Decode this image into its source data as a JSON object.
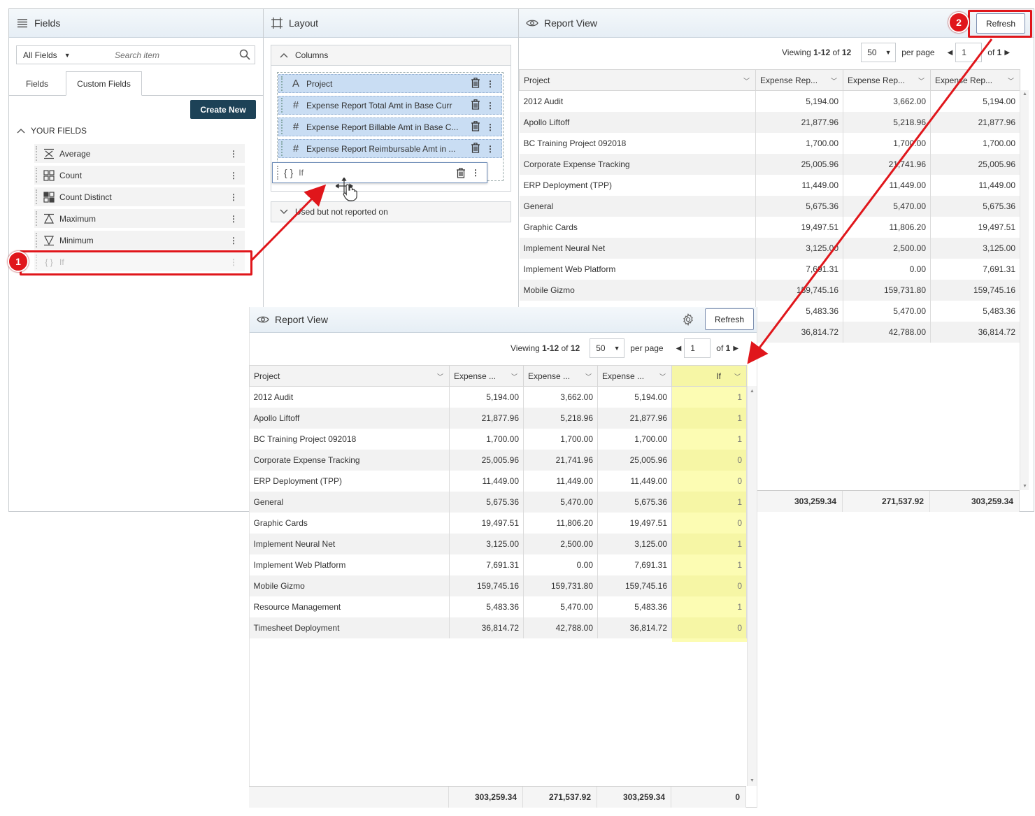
{
  "fields_panel": {
    "title": "Fields",
    "filter_select": "All Fields",
    "search_placeholder": "Search item",
    "tabs": [
      "Fields",
      "Custom Fields"
    ],
    "create_button": "Create New",
    "section_title": "YOUR FIELDS",
    "items": [
      {
        "label": "Average",
        "icon": "average-icon"
      },
      {
        "label": "Count",
        "icon": "count-icon"
      },
      {
        "label": "Count Distinct",
        "icon": "count-distinct-icon"
      },
      {
        "label": "Maximum",
        "icon": "maximum-icon"
      },
      {
        "label": "Minimum",
        "icon": "minimum-icon"
      },
      {
        "label": "If",
        "icon": "braces-icon"
      }
    ]
  },
  "layout_panel": {
    "title": "Layout",
    "columns_title": "Columns",
    "columns": [
      {
        "label": "Project",
        "icon": "text-icon"
      },
      {
        "label": "Expense Report Total Amt in Base Curr",
        "icon": "hash-icon"
      },
      {
        "label": "Expense Report Billable Amt in Base C...",
        "icon": "hash-icon"
      },
      {
        "label": "Expense Report Reimbursable Amt in ...",
        "icon": "hash-icon"
      }
    ],
    "dragged_item": "If",
    "unused_title": "Used but not reported on"
  },
  "report_top": {
    "title": "Report View",
    "refresh": "Refresh",
    "viewing_prefix": "Viewing ",
    "viewing_range": "1-12",
    "viewing_of": " of ",
    "viewing_total": "12",
    "per_page_value": "50",
    "per_page_label": "per page",
    "page_value": "1",
    "of_pages_prefix": "of ",
    "of_pages": "1",
    "headers": [
      "Project",
      "Expense Rep...",
      "Expense Rep...",
      "Expense Rep..."
    ],
    "totals": [
      "303,259.34",
      "271,537.92",
      "303,259.34"
    ]
  },
  "report_bottom": {
    "title": "Report View",
    "refresh": "Refresh",
    "viewing_prefix": "Viewing ",
    "viewing_range": "1-12",
    "viewing_of": " of ",
    "viewing_total": "12",
    "per_page_value": "50",
    "per_page_label": "per page",
    "page_value": "1",
    "of_pages_prefix": "of ",
    "of_pages": "1",
    "headers": [
      "Project",
      "Expense ...",
      "Expense ...",
      "Expense ...",
      "If"
    ],
    "totals": [
      "303,259.34",
      "271,537.92",
      "303,259.34",
      "0"
    ]
  },
  "rows": [
    {
      "project": "2012 Audit",
      "total": "5,194.00",
      "billable": "3,662.00",
      "reimb": "5,194.00",
      "if": "1"
    },
    {
      "project": "Apollo Liftoff",
      "total": "21,877.96",
      "billable": "5,218.96",
      "reimb": "21,877.96",
      "if": "1"
    },
    {
      "project": "BC Training Project 092018",
      "total": "1,700.00",
      "billable": "1,700.00",
      "reimb": "1,700.00",
      "if": "1"
    },
    {
      "project": "Corporate Expense Tracking",
      "total": "25,005.96",
      "billable": "21,741.96",
      "reimb": "25,005.96",
      "if": "0"
    },
    {
      "project": "ERP Deployment (TPP)",
      "total": "11,449.00",
      "billable": "11,449.00",
      "reimb": "11,449.00",
      "if": "0"
    },
    {
      "project": "General",
      "total": "5,675.36",
      "billable": "5,470.00",
      "reimb": "5,675.36",
      "if": "1"
    },
    {
      "project": "Graphic Cards",
      "total": "19,497.51",
      "billable": "11,806.20",
      "reimb": "19,497.51",
      "if": "0"
    },
    {
      "project": "Implement Neural Net",
      "total": "3,125.00",
      "billable": "2,500.00",
      "reimb": "3,125.00",
      "if": "1"
    },
    {
      "project": "Implement Web Platform",
      "total": "7,691.31",
      "billable": "0.00",
      "reimb": "7,691.31",
      "if": "1"
    },
    {
      "project": "Mobile Gizmo",
      "total": "159,745.16",
      "billable": "159,731.80",
      "reimb": "159,745.16",
      "if": "0"
    },
    {
      "project": "Resource Management",
      "total": "5,483.36",
      "billable": "5,470.00",
      "reimb": "5,483.36",
      "if": "1"
    },
    {
      "project": "Timesheet Deployment",
      "total": "36,814.72",
      "billable": "42,788.00",
      "reimb": "36,814.72",
      "if": "0"
    }
  ],
  "annotations": {
    "step1": "1",
    "step2": "2",
    "accent": "#e0161b"
  }
}
